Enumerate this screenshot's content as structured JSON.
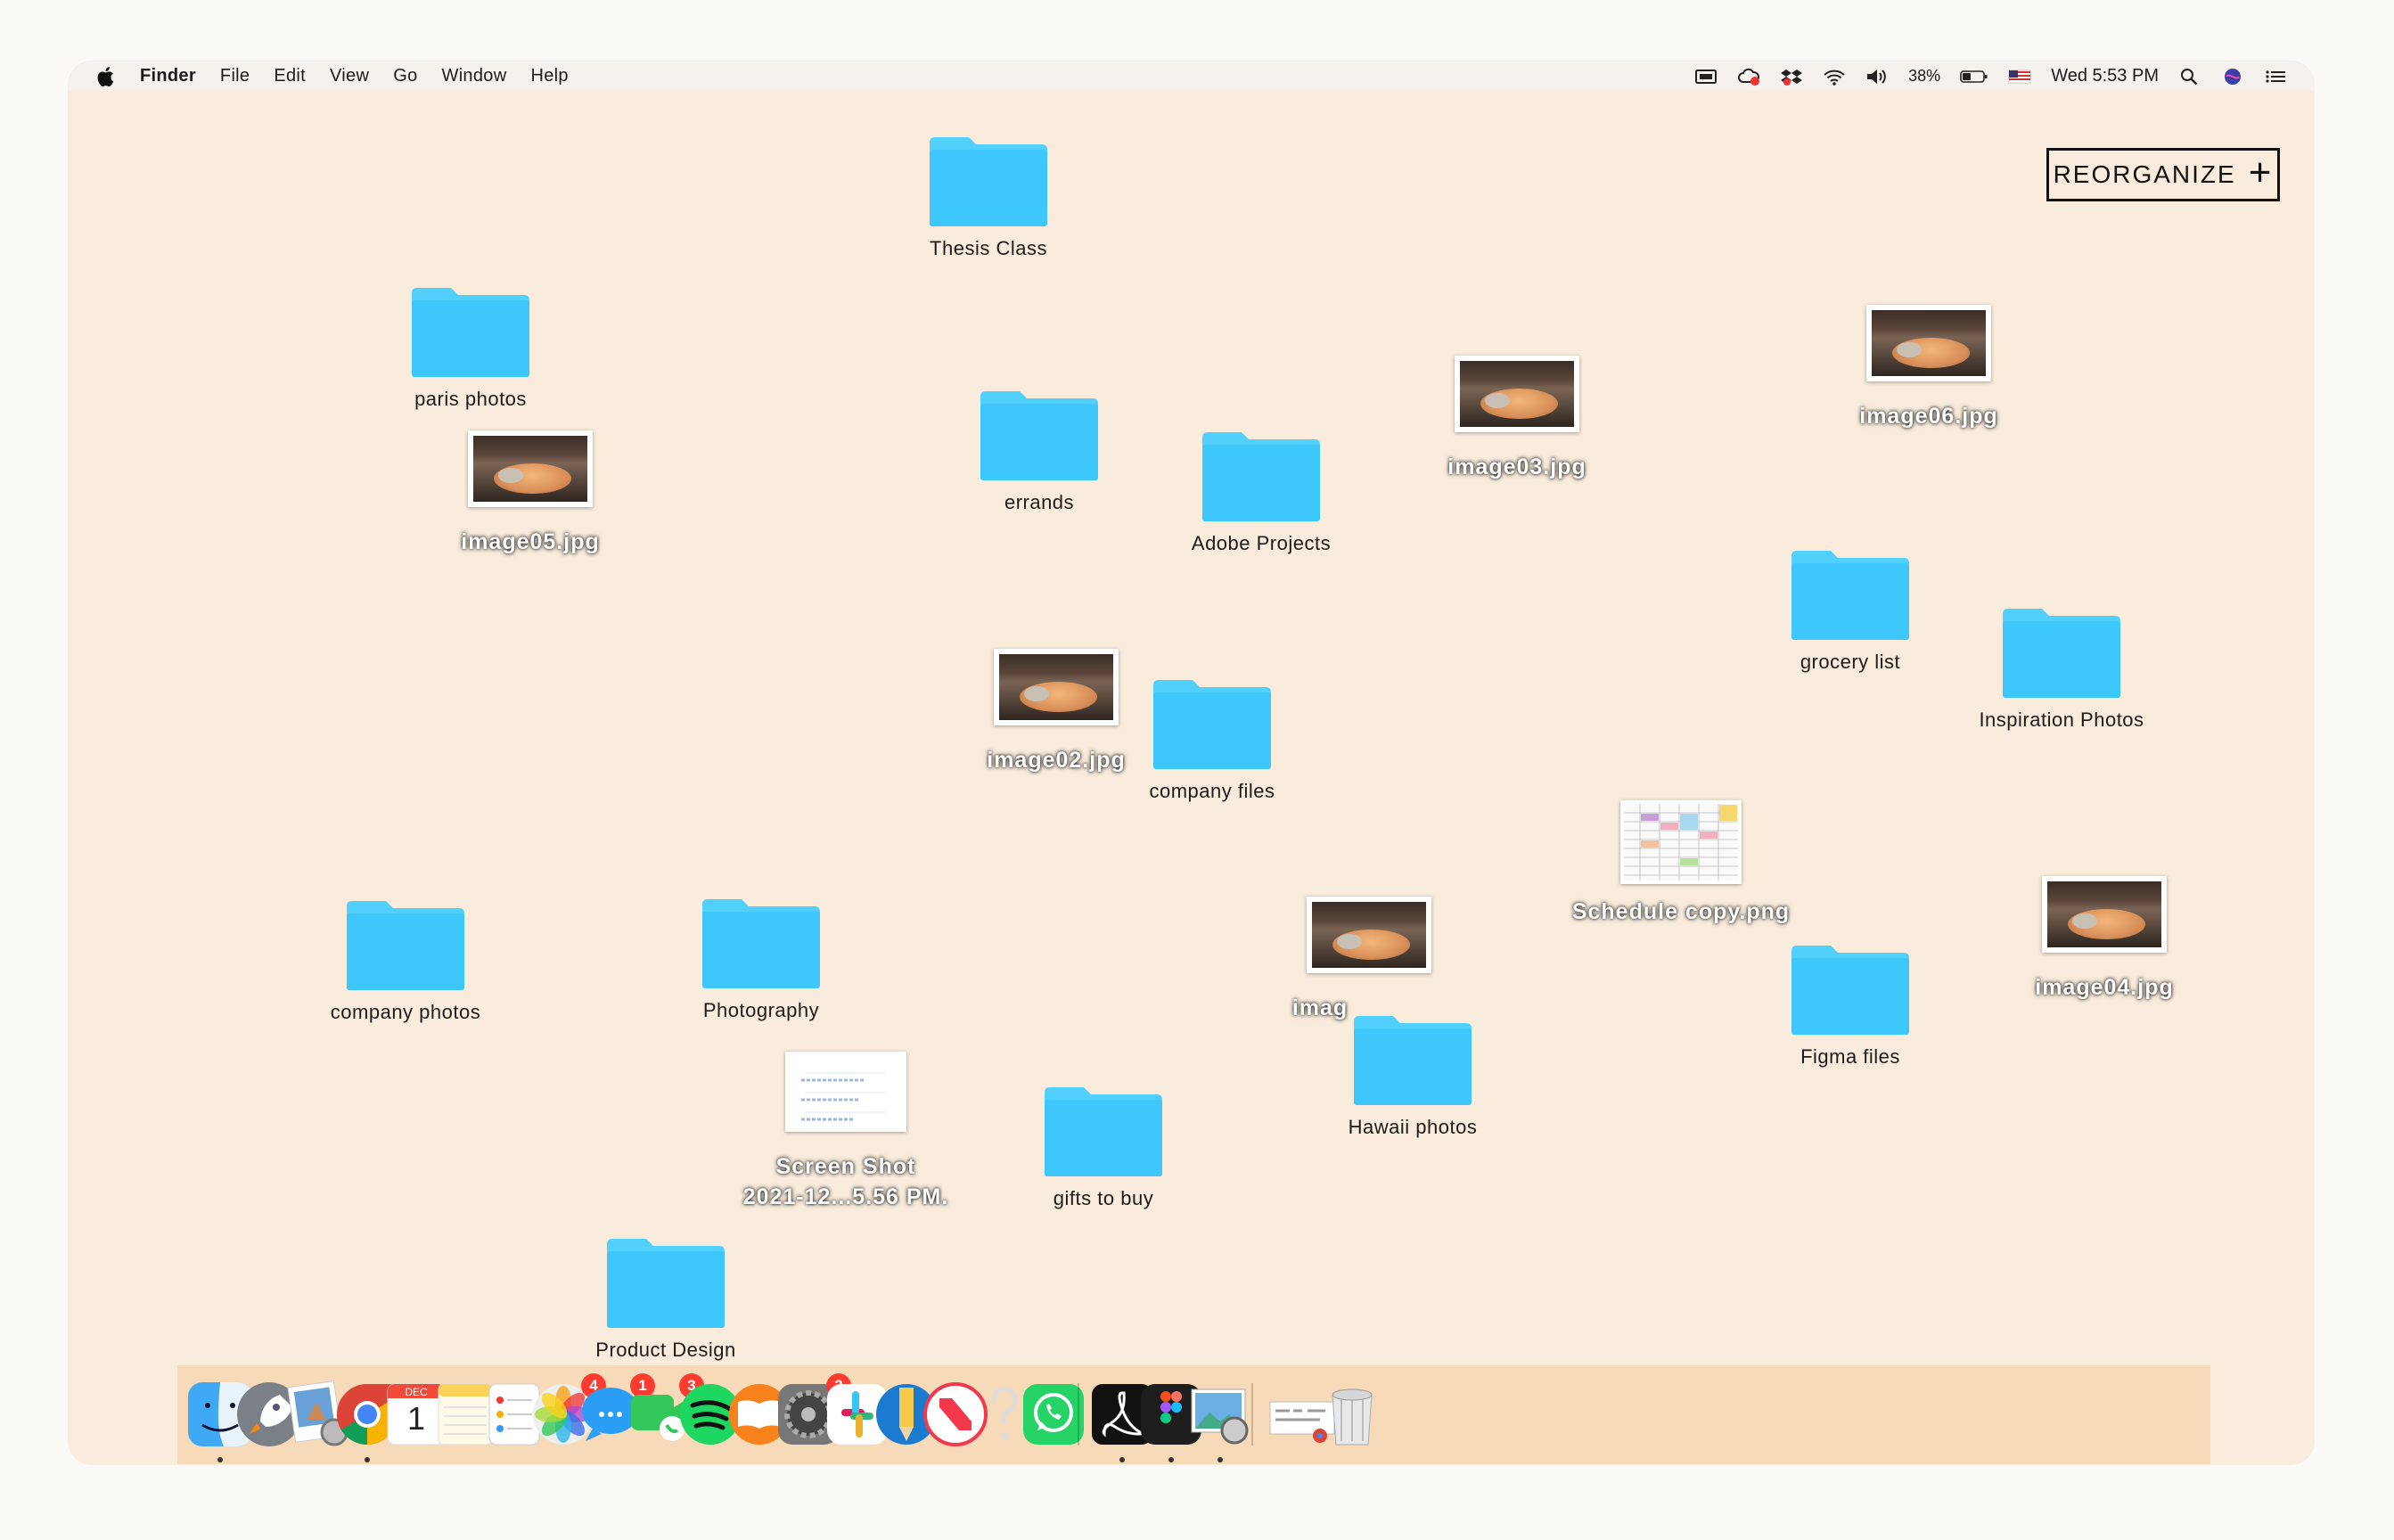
{
  "menubar": {
    "app_name": "Finder",
    "menus": [
      "File",
      "Edit",
      "View",
      "Go",
      "Window",
      "Help"
    ],
    "battery": "38%",
    "clock": "Wed 5:53 PM"
  },
  "reorganize": {
    "label": "REORGANIZE",
    "plus": "+"
  },
  "desktop": {
    "folders": {
      "thesis_class": "Thesis Class",
      "paris_photos": "paris photos",
      "errands": "errands",
      "adobe_projects": "Adobe Projects",
      "grocery_list": "grocery list",
      "inspiration_photos": "Inspiration Photos",
      "company_files": "company files",
      "company_photos": "company photos",
      "photography": "Photography",
      "figma_files": "Figma files",
      "hawaii_photos": "Hawaii photos",
      "gifts_to_buy": "gifts to buy",
      "product_design": "Product Design"
    },
    "files": {
      "image05": "image05.jpg",
      "image03": "image03.jpg",
      "image06": "image06.jpg",
      "image02": "image02.jpg",
      "image04": "image04.jpg",
      "image01_partial": "imag",
      "schedule": "Schedule copy.png",
      "screenshot_line1": "Screen Shot",
      "screenshot_line2": "2021-12...5.56 PM."
    }
  },
  "dock": {
    "badges": {
      "photos": "4",
      "messages": "1",
      "facetime": "3",
      "system_prefs": "2"
    },
    "calendar": {
      "month": "DEC",
      "day": "1"
    }
  },
  "colors": {
    "folder": "#3ec7fb",
    "folder_tab": "#52d0fc",
    "desktop": "#f9ecdc",
    "badge": "#ff3b30"
  }
}
